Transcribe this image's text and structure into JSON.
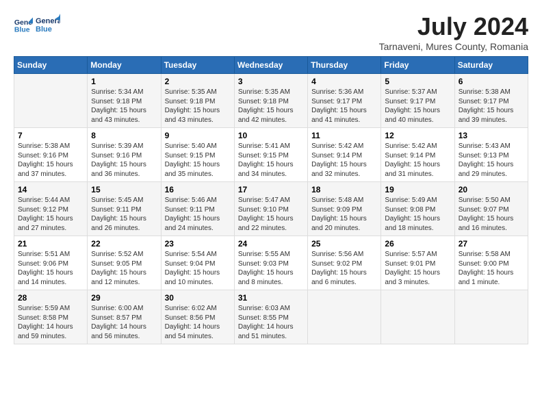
{
  "header": {
    "logo_line1": "General",
    "logo_line2": "Blue",
    "month": "July 2024",
    "location": "Tarnaveni, Mures County, Romania"
  },
  "days_of_week": [
    "Sunday",
    "Monday",
    "Tuesday",
    "Wednesday",
    "Thursday",
    "Friday",
    "Saturday"
  ],
  "weeks": [
    [
      {
        "day": "",
        "text": ""
      },
      {
        "day": "1",
        "text": "Sunrise: 5:34 AM\nSunset: 9:18 PM\nDaylight: 15 hours\nand 43 minutes."
      },
      {
        "day": "2",
        "text": "Sunrise: 5:35 AM\nSunset: 9:18 PM\nDaylight: 15 hours\nand 43 minutes."
      },
      {
        "day": "3",
        "text": "Sunrise: 5:35 AM\nSunset: 9:18 PM\nDaylight: 15 hours\nand 42 minutes."
      },
      {
        "day": "4",
        "text": "Sunrise: 5:36 AM\nSunset: 9:17 PM\nDaylight: 15 hours\nand 41 minutes."
      },
      {
        "day": "5",
        "text": "Sunrise: 5:37 AM\nSunset: 9:17 PM\nDaylight: 15 hours\nand 40 minutes."
      },
      {
        "day": "6",
        "text": "Sunrise: 5:38 AM\nSunset: 9:17 PM\nDaylight: 15 hours\nand 39 minutes."
      }
    ],
    [
      {
        "day": "7",
        "text": "Sunrise: 5:38 AM\nSunset: 9:16 PM\nDaylight: 15 hours\nand 37 minutes."
      },
      {
        "day": "8",
        "text": "Sunrise: 5:39 AM\nSunset: 9:16 PM\nDaylight: 15 hours\nand 36 minutes."
      },
      {
        "day": "9",
        "text": "Sunrise: 5:40 AM\nSunset: 9:15 PM\nDaylight: 15 hours\nand 35 minutes."
      },
      {
        "day": "10",
        "text": "Sunrise: 5:41 AM\nSunset: 9:15 PM\nDaylight: 15 hours\nand 34 minutes."
      },
      {
        "day": "11",
        "text": "Sunrise: 5:42 AM\nSunset: 9:14 PM\nDaylight: 15 hours\nand 32 minutes."
      },
      {
        "day": "12",
        "text": "Sunrise: 5:42 AM\nSunset: 9:14 PM\nDaylight: 15 hours\nand 31 minutes."
      },
      {
        "day": "13",
        "text": "Sunrise: 5:43 AM\nSunset: 9:13 PM\nDaylight: 15 hours\nand 29 minutes."
      }
    ],
    [
      {
        "day": "14",
        "text": "Sunrise: 5:44 AM\nSunset: 9:12 PM\nDaylight: 15 hours\nand 27 minutes."
      },
      {
        "day": "15",
        "text": "Sunrise: 5:45 AM\nSunset: 9:11 PM\nDaylight: 15 hours\nand 26 minutes."
      },
      {
        "day": "16",
        "text": "Sunrise: 5:46 AM\nSunset: 9:11 PM\nDaylight: 15 hours\nand 24 minutes."
      },
      {
        "day": "17",
        "text": "Sunrise: 5:47 AM\nSunset: 9:10 PM\nDaylight: 15 hours\nand 22 minutes."
      },
      {
        "day": "18",
        "text": "Sunrise: 5:48 AM\nSunset: 9:09 PM\nDaylight: 15 hours\nand 20 minutes."
      },
      {
        "day": "19",
        "text": "Sunrise: 5:49 AM\nSunset: 9:08 PM\nDaylight: 15 hours\nand 18 minutes."
      },
      {
        "day": "20",
        "text": "Sunrise: 5:50 AM\nSunset: 9:07 PM\nDaylight: 15 hours\nand 16 minutes."
      }
    ],
    [
      {
        "day": "21",
        "text": "Sunrise: 5:51 AM\nSunset: 9:06 PM\nDaylight: 15 hours\nand 14 minutes."
      },
      {
        "day": "22",
        "text": "Sunrise: 5:52 AM\nSunset: 9:05 PM\nDaylight: 15 hours\nand 12 minutes."
      },
      {
        "day": "23",
        "text": "Sunrise: 5:54 AM\nSunset: 9:04 PM\nDaylight: 15 hours\nand 10 minutes."
      },
      {
        "day": "24",
        "text": "Sunrise: 5:55 AM\nSunset: 9:03 PM\nDaylight: 15 hours\nand 8 minutes."
      },
      {
        "day": "25",
        "text": "Sunrise: 5:56 AM\nSunset: 9:02 PM\nDaylight: 15 hours\nand 6 minutes."
      },
      {
        "day": "26",
        "text": "Sunrise: 5:57 AM\nSunset: 9:01 PM\nDaylight: 15 hours\nand 3 minutes."
      },
      {
        "day": "27",
        "text": "Sunrise: 5:58 AM\nSunset: 9:00 PM\nDaylight: 15 hours\nand 1 minute."
      }
    ],
    [
      {
        "day": "28",
        "text": "Sunrise: 5:59 AM\nSunset: 8:58 PM\nDaylight: 14 hours\nand 59 minutes."
      },
      {
        "day": "29",
        "text": "Sunrise: 6:00 AM\nSunset: 8:57 PM\nDaylight: 14 hours\nand 56 minutes."
      },
      {
        "day": "30",
        "text": "Sunrise: 6:02 AM\nSunset: 8:56 PM\nDaylight: 14 hours\nand 54 minutes."
      },
      {
        "day": "31",
        "text": "Sunrise: 6:03 AM\nSunset: 8:55 PM\nDaylight: 14 hours\nand 51 minutes."
      },
      {
        "day": "",
        "text": ""
      },
      {
        "day": "",
        "text": ""
      },
      {
        "day": "",
        "text": ""
      }
    ]
  ]
}
